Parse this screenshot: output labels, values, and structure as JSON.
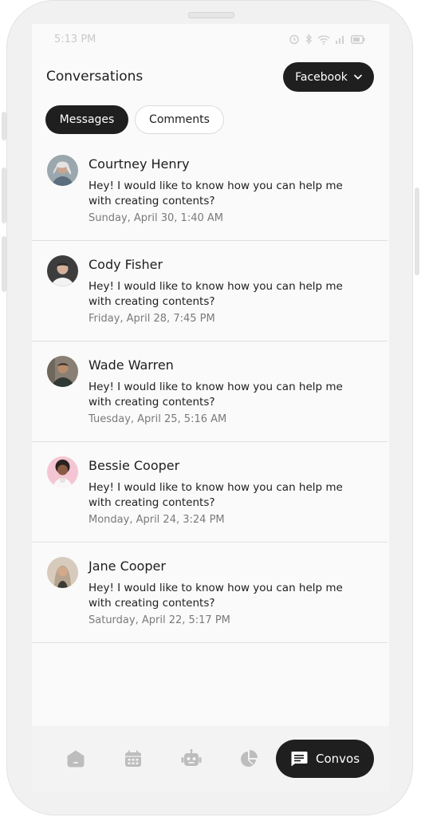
{
  "status_bar": {
    "time": "5:13 PM"
  },
  "header": {
    "title": "Conversations",
    "platform_select": "Facebook"
  },
  "tabs": [
    {
      "label": "Messages",
      "active": true
    },
    {
      "label": "Comments",
      "active": false
    }
  ],
  "conversations": [
    {
      "name": "Courtney Henry",
      "message": "Hey! I would like to know how you can help me with creating contents?",
      "time": "Sunday, April 30, 1:40 AM"
    },
    {
      "name": "Cody Fisher",
      "message": "Hey! I would like to know how you can help me with creating contents?",
      "time": "Friday, April 28, 7:45 PM"
    },
    {
      "name": "Wade Warren",
      "message": "Hey! I would like to know how you can help me with creating contents?",
      "time": "Tuesday, April 25, 5:16 AM"
    },
    {
      "name": "Bessie Cooper",
      "message": "Hey! I would like to know how you can help me with creating contents?",
      "time": "Monday, April 24, 3:24 PM"
    },
    {
      "name": "Jane Cooper",
      "message": "Hey! I would like to know how you can help me with creating contents?",
      "time": "Saturday, April 22, 5:17 PM"
    }
  ],
  "bottom_nav": {
    "items": [
      {
        "icon": "home-icon"
      },
      {
        "icon": "calendar-icon"
      },
      {
        "icon": "robot-icon"
      },
      {
        "icon": "pie-chart-icon"
      }
    ],
    "active_label": "Convos",
    "active_icon": "chat-icon"
  }
}
